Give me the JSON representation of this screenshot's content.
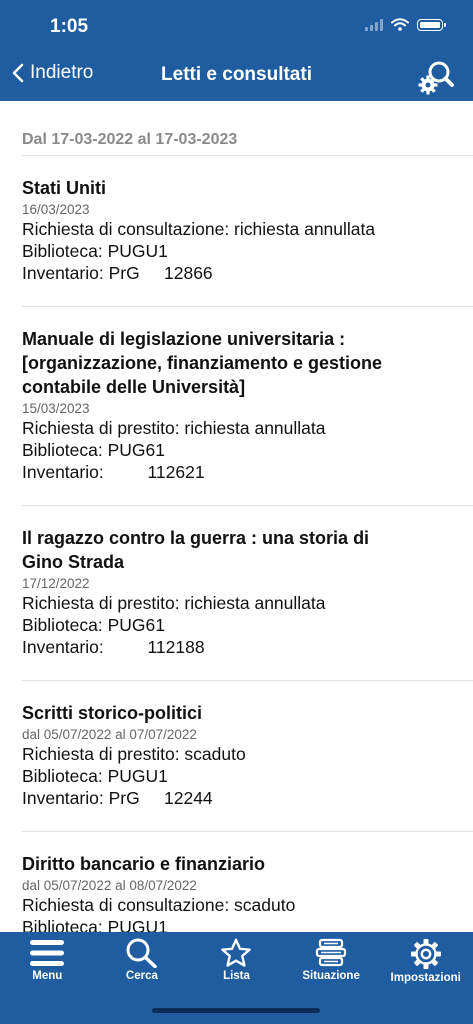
{
  "status_bar": {
    "time": "1:05"
  },
  "header": {
    "back_label": "Indietro",
    "title": "Letti e consultati"
  },
  "date_range": "Dal 17-03-2022 al 17-03-2023",
  "items": [
    {
      "title": "Stati Uniti",
      "date": "16/03/2023",
      "status": "Richiesta di consultazione: richiesta annullata",
      "library": "Biblioteca: PUGU1",
      "inventory": "Inventario: PrG     12866"
    },
    {
      "title": "Manuale di legislazione universitaria : [organizzazione, finanziamento e gestione contabile delle Università]",
      "date": "15/03/2023",
      "status": "Richiesta di prestito: richiesta annullata",
      "library": "Biblioteca: PUG61",
      "inventory": "Inventario:         112621"
    },
    {
      "title": "Il ragazzo contro la guerra : una storia di Gino Strada",
      "date": "17/12/2022",
      "status": "Richiesta di prestito: richiesta annullata",
      "library": "Biblioteca: PUG61",
      "inventory": "Inventario:         112188"
    },
    {
      "title": "Scritti storico-politici",
      "date": "dal 05/07/2022 al 07/07/2022",
      "status": "Richiesta di prestito: scaduto",
      "library": "Biblioteca: PUGU1",
      "inventory": "Inventario: PrG     12244"
    },
    {
      "title": "Diritto bancario e finanziario",
      "date": "dal 05/07/2022 al 08/07/2022",
      "status": "Richiesta di consultazione: scaduto",
      "library": "Biblioteca: PUGU1",
      "inventory": ""
    }
  ],
  "tabbar": {
    "menu": "Menu",
    "search": "Cerca",
    "list": "Lista",
    "situation": "Situazione",
    "settings": "Impostazioni"
  },
  "icons": {
    "back": "chevron-left-icon",
    "search_settings": "search-gear-icon",
    "menu": "hamburger-icon",
    "search": "search-icon",
    "list": "star-icon",
    "situation": "books-stack-icon",
    "settings": "gear-icon"
  },
  "colors": {
    "header_bg": "#1f5da0",
    "tabbar_bg": "#1f5da0",
    "accent_text": "#ffffff"
  }
}
